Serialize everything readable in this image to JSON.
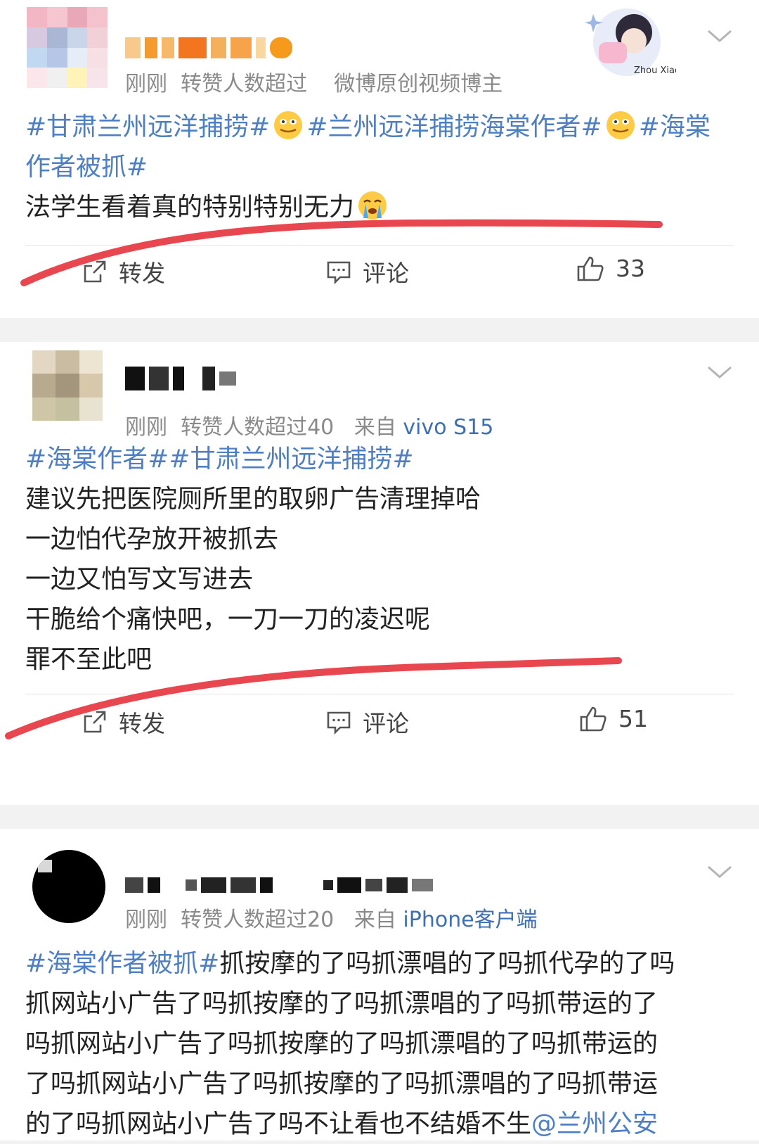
{
  "posts": [
    {
      "meta_time": "刚刚",
      "meta_stats": "转赞人数超过",
      "meta_role": "微博原创视频博主",
      "badge_text": "Zhou Xiao",
      "hashtags": [
        "#甘肃兰州远洋捕捞#",
        "#兰州远洋捕捞海棠作者#",
        "#海棠作者被抓#"
      ],
      "text_lines": [
        "法学生看着真的特别特别无力"
      ],
      "actions": {
        "repost": "转发",
        "comment": "评论",
        "likes": "33"
      }
    },
    {
      "meta_time": "刚刚",
      "meta_stats": "转赞人数超过40",
      "meta_from": "来自",
      "meta_source": "vivo S15",
      "hashtags": [
        "#海棠作者##甘肃兰州远洋捕捞#"
      ],
      "text_lines": [
        "建议先把医院厕所里的取卵广告清理掉哈",
        "一边怕代孕放开被抓去",
        "一边又怕写文写进去",
        "干脆给个痛快吧，一刀一刀的凌迟呢",
        "罪不至此吧"
      ],
      "actions": {
        "repost": "转发",
        "comment": "评论",
        "likes": "51"
      }
    },
    {
      "meta_time": "刚刚",
      "meta_stats": "转赞人数超过20",
      "meta_from": "来自",
      "meta_source": "iPhone客户端",
      "hashtag": "#海棠作者被抓#",
      "text_lines": [
        "抓按摩的了吗抓漂唱的了吗抓代孕的了吗",
        "抓网站小广告了吗抓按摩的了吗抓漂唱的了吗抓带运的了",
        "吗抓网站小广告了吗抓按摩的了吗抓漂唱的了吗抓带运的",
        "了吗抓网站小广告了吗抓按摩的了吗抓漂唱的了吗抓带运",
        "的了吗抓网站小广告了吗不让看也不结婚不生"
      ],
      "mention": "@兰州公安"
    }
  ],
  "colors": {
    "link": "#4e7fc4",
    "annotation": "#e8474f",
    "meta": "#8a8a8a"
  },
  "icons": [
    "repost-icon",
    "comment-icon",
    "like-icon",
    "chevron-down-icon",
    "grimace-emoji",
    "crying-emoji"
  ]
}
